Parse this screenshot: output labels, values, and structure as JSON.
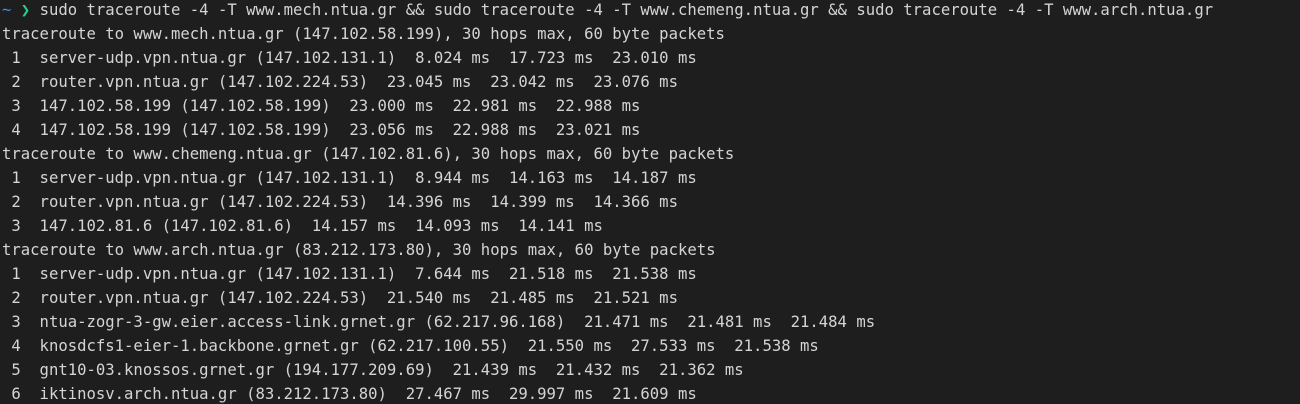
{
  "prompt": {
    "cwd": "~",
    "arrow": "❯",
    "command": "sudo traceroute -4 -T www.mech.ntua.gr && sudo traceroute -4 -T www.chemeng.ntua.gr && sudo traceroute -4 -T www.arch.ntua.gr"
  },
  "colors": {
    "background": "#1e1e1e",
    "foreground": "#d4d4d4",
    "prompt_tilde": "#3b8eea",
    "prompt_arrow": "#23d18b"
  },
  "output_lines": [
    "traceroute to www.mech.ntua.gr (147.102.58.199), 30 hops max, 60 byte packets",
    " 1  server-udp.vpn.ntua.gr (147.102.131.1)  8.024 ms  17.723 ms  23.010 ms",
    " 2  router.vpn.ntua.gr (147.102.224.53)  23.045 ms  23.042 ms  23.076 ms",
    " 3  147.102.58.199 (147.102.58.199)  23.000 ms  22.981 ms  22.988 ms",
    " 4  147.102.58.199 (147.102.58.199)  23.056 ms  22.988 ms  23.021 ms",
    "traceroute to www.chemeng.ntua.gr (147.102.81.6), 30 hops max, 60 byte packets",
    " 1  server-udp.vpn.ntua.gr (147.102.131.1)  8.944 ms  14.163 ms  14.187 ms",
    " 2  router.vpn.ntua.gr (147.102.224.53)  14.396 ms  14.399 ms  14.366 ms",
    " 3  147.102.81.6 (147.102.81.6)  14.157 ms  14.093 ms  14.141 ms",
    "traceroute to www.arch.ntua.gr (83.212.173.80), 30 hops max, 60 byte packets",
    " 1  server-udp.vpn.ntua.gr (147.102.131.1)  7.644 ms  21.518 ms  21.538 ms",
    " 2  router.vpn.ntua.gr (147.102.224.53)  21.540 ms  21.485 ms  21.521 ms",
    " 3  ntua-zogr-3-gw.eier.access-link.grnet.gr (62.217.96.168)  21.471 ms  21.481 ms  21.484 ms",
    " 4  knosdcfs1-eier-1.backbone.grnet.gr (62.217.100.55)  21.550 ms  27.533 ms  21.538 ms",
    " 5  gnt10-03.knossos.grnet.gr (194.177.209.69)  21.439 ms  21.432 ms  21.362 ms",
    " 6  iktinosv.arch.ntua.gr (83.212.173.80)  27.467 ms  29.997 ms  21.609 ms"
  ]
}
